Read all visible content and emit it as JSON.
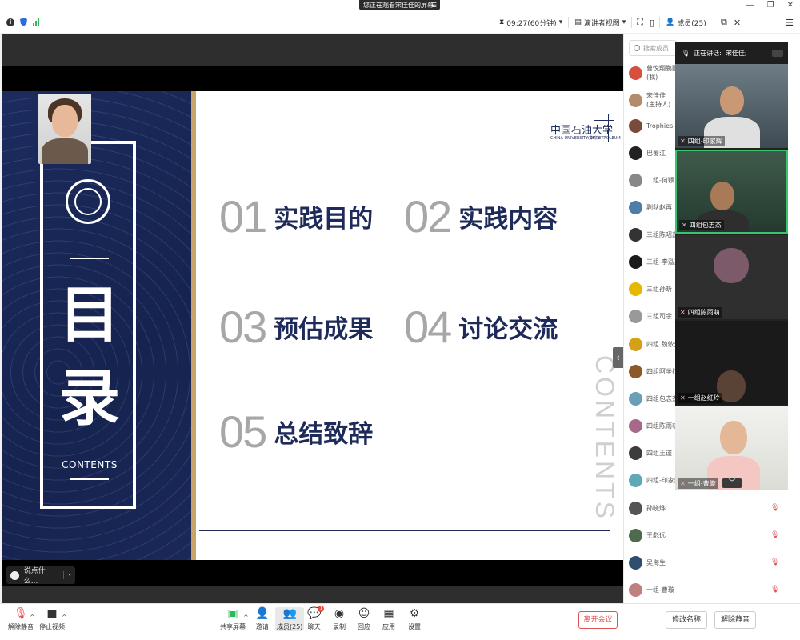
{
  "banner": {
    "text": "您正在观看宋佳佳的屏幕",
    "menu_icon": "hamburger-icon"
  },
  "topbar": {
    "timer": "09:27(60分钟)",
    "view_mode": "演讲者视图",
    "members_label": "成员(25)"
  },
  "slide": {
    "left_title_1": "目",
    "left_title_2": "录",
    "left_sub": "CONTENTS",
    "logo": "中国石油大学",
    "logo_sub": "CHINA UNIVERSITY OF PETROLEUM",
    "logo_mark": "(华东)",
    "vertical": "CONTENTS",
    "items": [
      {
        "num": "01",
        "label": "实践目的"
      },
      {
        "num": "02",
        "label": "实践内容"
      },
      {
        "num": "03",
        "label": "预估成果"
      },
      {
        "num": "04",
        "label": "讨论交流"
      },
      {
        "num": "05",
        "label": "总结致辞"
      }
    ]
  },
  "chat": {
    "placeholder": "说点什么..."
  },
  "members": {
    "search_placeholder": "搜索成员",
    "list": [
      {
        "name": "曾悦翔鹏翻",
        "sub": "(我)",
        "color": "#d94f3d"
      },
      {
        "name": "宋佳佳",
        "sub": "(主持人)",
        "color": "#b38b6d"
      },
      {
        "name": "Trophies",
        "sub": "",
        "color": "#7a4b3a"
      },
      {
        "name": "巴蜀江",
        "sub": "",
        "color": "#222222"
      },
      {
        "name": "二组-何颖",
        "sub": "",
        "color": "#888888"
      },
      {
        "name": "副队赵再",
        "sub": "",
        "color": "#4d7ea8"
      },
      {
        "name": "三组陈昭鑫",
        "sub": "",
        "color": "#333333"
      },
      {
        "name": "三组-李泓兆",
        "sub": "",
        "color": "#1a1a1a"
      },
      {
        "name": "三组孙昕",
        "sub": "",
        "color": "#e6b800"
      },
      {
        "name": "三组司余",
        "sub": "",
        "color": "#999999"
      },
      {
        "name": "四组 魏依梵",
        "sub": "",
        "color": "#d4a017"
      },
      {
        "name": "四组阿坐拉",
        "sub": "",
        "color": "#8b5a2b"
      },
      {
        "name": "四组包志杰",
        "sub": "",
        "color": "#6a9fb5"
      },
      {
        "name": "四组陈雨萌",
        "sub": "",
        "color": "#a56a8a"
      },
      {
        "name": "四组王谨",
        "sub": "",
        "color": "#3d3d3d"
      },
      {
        "name": "四组-印家辉",
        "sub": "",
        "color": "#5fa8b5"
      },
      {
        "name": "孙晓烨",
        "sub": "",
        "color": "#555555"
      },
      {
        "name": "王彪远",
        "sub": "",
        "color": "#4f6b4f"
      },
      {
        "name": "吴海生",
        "sub": "",
        "color": "#2f4f6f"
      },
      {
        "name": "一组-曹璇",
        "sub": "",
        "color": "#c08080"
      }
    ]
  },
  "videos": {
    "speaking_label": "正在讲话:",
    "speaking_name": "宋佳佳;",
    "tiles": [
      "四组-印家辉",
      "四组包志杰",
      "四组陈雨萌",
      "一组赵红玲",
      "一组-曹璇"
    ]
  },
  "toolbar": {
    "unmute": "解除静音",
    "stop_video": "停止视频",
    "share": "共享屏幕",
    "invite": "邀请",
    "members": "成员(25)",
    "chat": "聊天",
    "chat_badge": "1",
    "record": "录制",
    "reaction": "回应",
    "apps": "应用",
    "settings": "设置",
    "leave": "离开会议",
    "rename": "修改名称",
    "unmute_all": "解除静音"
  }
}
